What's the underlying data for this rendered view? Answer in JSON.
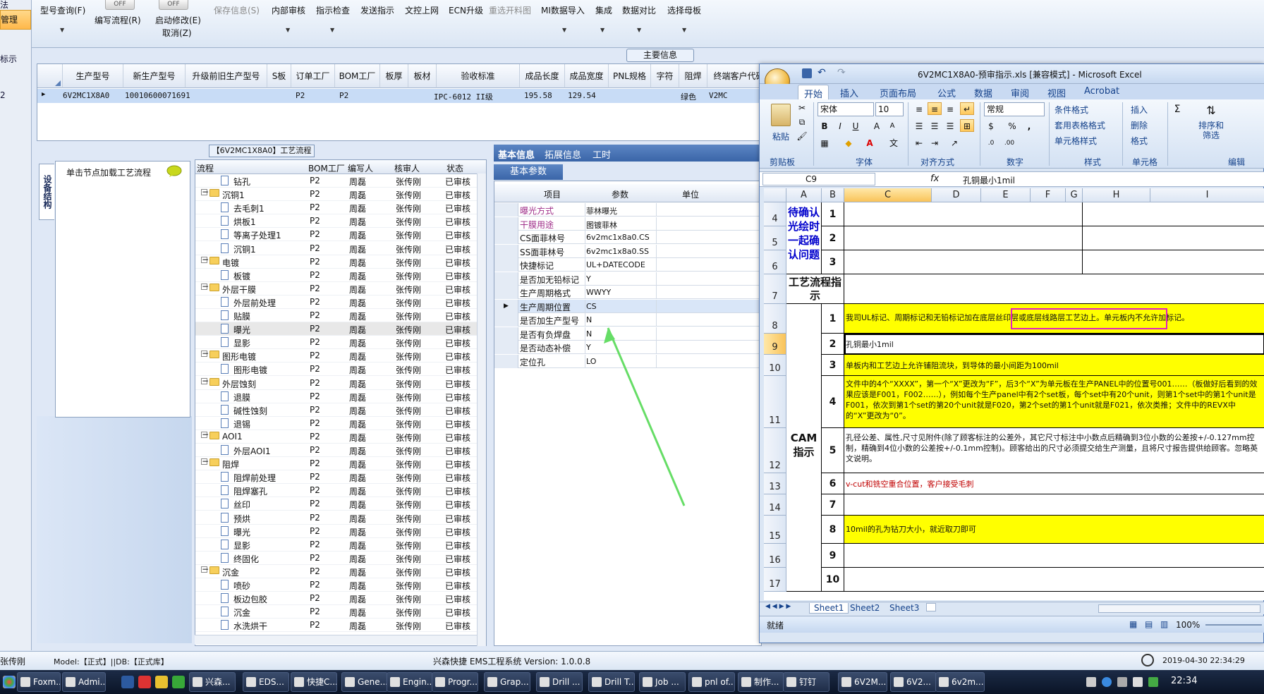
{
  "app": {
    "toolbar": {
      "type_query": "型号查询(F)",
      "edit_flow": "编写流程(R)",
      "start_modify": "启动修改(E)",
      "cancel": "取消(Z)",
      "save_info": "保存信息(S)",
      "internal_review": "内部审核",
      "instruction_check": "指示检查",
      "send_instruction": "发送指示",
      "upload": "文控上网",
      "ecn_upgrade": "ECN升级",
      "reselect_material": "重选开料图",
      "mi_import": "MI数据导入",
      "integration": "集成",
      "data_compare": "数据对比",
      "select_master": "选择母板",
      "toggle_off": "OFF"
    },
    "left_strip": {
      "top": "法",
      "selected": "管理",
      "item2": "标示",
      "item3": "2"
    },
    "main_info_tab": "主要信息",
    "main_grid": {
      "headers": [
        "生产型号",
        "新生产型号",
        "升级前旧生产型号",
        "S板",
        "订单工厂",
        "BOM工厂",
        "板厚",
        "板材",
        "验收标准",
        "成品长度",
        "成品宽度",
        "PNL规格",
        "字符",
        "阻焊",
        "终端客户代码"
      ],
      "row": {
        "prod_model": "6V2MC1X8A0",
        "new_model": "10010600071691",
        "order_factory": "P2",
        "bom_factory": "P2",
        "standard": "IPC-6012 II级",
        "length": "195.58",
        "width": "129.54",
        "solder": "绿色",
        "customer": "V2MC"
      }
    },
    "side_tab": "设备结构",
    "load_hint": "单击节点加载工艺流程",
    "process": {
      "title": "【6V2MC1X8A0】工艺流程",
      "headers": [
        "流程",
        "BOM工厂",
        "编写人",
        "核审人",
        "状态"
      ],
      "factory": "P2",
      "writer": "周磊",
      "reviewer": "张传刚",
      "status": "已审核",
      "rows": [
        {
          "label": "钻孔",
          "type": "file",
          "level": 2
        },
        {
          "label": "沉铜1",
          "type": "folder",
          "level": 1
        },
        {
          "label": "去毛刺1",
          "type": "file",
          "level": 2
        },
        {
          "label": "烘板1",
          "type": "file",
          "level": 2
        },
        {
          "label": "等离子处理1",
          "type": "file",
          "level": 2
        },
        {
          "label": "沉铜1",
          "type": "file",
          "level": 2
        },
        {
          "label": "电镀",
          "type": "folder",
          "level": 1
        },
        {
          "label": "板镀",
          "type": "file",
          "level": 2
        },
        {
          "label": "外层干膜",
          "type": "folder",
          "level": 1
        },
        {
          "label": "外层前处理",
          "type": "file",
          "level": 2
        },
        {
          "label": "贴膜",
          "type": "file",
          "level": 2
        },
        {
          "label": "曝光",
          "type": "file",
          "level": 2,
          "selected": true
        },
        {
          "label": "显影",
          "type": "file",
          "level": 2
        },
        {
          "label": "图形电镀",
          "type": "folder",
          "level": 1
        },
        {
          "label": "图形电镀",
          "type": "file",
          "level": 2
        },
        {
          "label": "外层蚀刻",
          "type": "folder",
          "level": 1
        },
        {
          "label": "退膜",
          "type": "file",
          "level": 2
        },
        {
          "label": "碱性蚀刻",
          "type": "file",
          "level": 2
        },
        {
          "label": "退锡",
          "type": "file",
          "level": 2
        },
        {
          "label": "AOI1",
          "type": "folder",
          "level": 1
        },
        {
          "label": "外层AOI1",
          "type": "file",
          "level": 2
        },
        {
          "label": "阻焊",
          "type": "folder",
          "level": 1
        },
        {
          "label": "阻焊前处理",
          "type": "file",
          "level": 2
        },
        {
          "label": "阻焊塞孔",
          "type": "file",
          "level": 2
        },
        {
          "label": "丝印",
          "type": "file",
          "level": 2
        },
        {
          "label": "预烘",
          "type": "file",
          "level": 2
        },
        {
          "label": "曝光",
          "type": "file",
          "level": 2
        },
        {
          "label": "显影",
          "type": "file",
          "level": 2
        },
        {
          "label": "终固化",
          "type": "file",
          "level": 2
        },
        {
          "label": "沉金",
          "type": "folder",
          "level": 1
        },
        {
          "label": "喷砂",
          "type": "file",
          "level": 2
        },
        {
          "label": "板边包胶",
          "type": "file",
          "level": 2
        },
        {
          "label": "沉金",
          "type": "file",
          "level": 2
        },
        {
          "label": "水洗烘干",
          "type": "file",
          "level": 2
        }
      ]
    },
    "info_tabs": [
      "基本信息",
      "拓展信息",
      "工时"
    ],
    "basic_param_tab": "基本参数",
    "params": {
      "headers": [
        "项目",
        "参数",
        "单位"
      ],
      "rows": [
        {
          "k": "曝光方式",
          "v": "菲林曝光",
          "pink": true
        },
        {
          "k": "干膜用途",
          "v": "图镀菲林",
          "pink": true
        },
        {
          "k": "CS面菲林号",
          "v": "6v2mc1x8a0.CS"
        },
        {
          "k": "SS面菲林号",
          "v": "6v2mc1x8a0.SS"
        },
        {
          "k": "快捷标记",
          "v": "UL+DATECODE"
        },
        {
          "k": "是否加无铅标记",
          "v": "Y"
        },
        {
          "k": "生产周期格式",
          "v": "WWYY"
        },
        {
          "k": "生产周期位置",
          "v": "CS",
          "selected": true
        },
        {
          "k": "是否加生产型号",
          "v": "N"
        },
        {
          "k": "是否有负焊盘",
          "v": "N"
        },
        {
          "k": "是否动态补偿",
          "v": "Y"
        },
        {
          "k": "定位孔",
          "v": "LO"
        }
      ]
    },
    "status": {
      "user": "张传刚",
      "model": "Model:【正式】||DB:【正式库】",
      "system": "兴森快捷 EMS工程系统 Version: 1.0.0.8",
      "datetime": "2019-04-30 22:34:29"
    }
  },
  "excel": {
    "title": "6V2MC1X8A0-预审指示.xls [兼容模式] - Microsoft Excel",
    "tabs": [
      "开始",
      "插入",
      "页面布局",
      "公式",
      "数据",
      "审阅",
      "视图",
      "Acrobat"
    ],
    "ribbon": {
      "paste": "粘贴",
      "clipboard": "剪贴板",
      "font_name": "宋体",
      "font_size": "10",
      "font": "字体",
      "align": "对齐方式",
      "number_format": "常规",
      "number": "数字",
      "cond_format": "条件格式",
      "table_format": "套用表格格式",
      "cell_style": "单元格样式",
      "style": "样式",
      "insert": "插入",
      "delete": "删除",
      "format": "格式",
      "cells": "单元格",
      "sort_filter": "排序和筛选",
      "edit": "编辑"
    },
    "cell_ref": "C9",
    "formula": "孔铜最小1mil",
    "columns": [
      "A",
      "B",
      "C",
      "D",
      "E",
      "F",
      "G",
      "H",
      "I"
    ],
    "rows": [
      "4",
      "5",
      "6",
      "7",
      "8",
      "9",
      "10",
      "11",
      "12",
      "13",
      "14",
      "15",
      "16",
      "17"
    ],
    "confirm_label": "待确认光绘时一起确认问题",
    "process_label": "工艺流程指示",
    "cam_label": "CAM指示",
    "nums": [
      "1",
      "2",
      "3",
      "1",
      "2",
      "3",
      "4",
      "5",
      "6",
      "7",
      "8",
      "9",
      "10"
    ],
    "content": {
      "r1": "我司UL标记、周期标记和无铅标记加在底层丝印层或底层线路层工艺边上。单元板内不允许加标记。",
      "r2": "孔铜最小1mil",
      "r3": "单板内和工艺边上允许铺阻流块，到导体的最小间距为100mil",
      "r4": "文件中的4个“XXXX”，第一个“X”更改为“F”，后3个“X”为单元板在生产PANEL中的位置号001……（板做好后看到的效果应该是F001，F002……），例如每个生产panel中有2个set板，每个set中有20个unit，则第1个set中的第1个unit是F001，依次到第1个set的第20个unit就是F020，第2个set的第1个unit就是F021，依次类推；文件中的REVX中的“X”更改为“0”。",
      "r5": "孔径公差、属性,尺寸见附件(除了顾客标注的公差外，其它尺寸标注中小数点后精确到3位小数的公差按+/-0.127mm控制，精确到4位小数的公差按+/-0.1mm控制)。顾客给出的尺寸必须提交给生产测量，且将尺寸报告提供给顾客。忽略英文说明。",
      "r6": "v-cut和铣空重合位置，客户接受毛刺",
      "r8": "10mil的孔为钻刀大小，就近取刀即可"
    },
    "sheets": [
      "Sheet1",
      "Sheet2",
      "Sheet3"
    ],
    "ready": "就绪",
    "zoom": "100%"
  },
  "taskbar": {
    "items": [
      "Foxm...",
      "Admi...",
      "兴森...",
      "EDS...",
      "快捷C...",
      "Gene...",
      "Engin...",
      "Progr...",
      "Grap...",
      "Drill ...",
      "Drill T...",
      "Job ...",
      "pnl of...",
      "制作...",
      "钉钉",
      "6V2M...",
      "6V2...",
      "6v2m..."
    ],
    "time": "22:34"
  }
}
